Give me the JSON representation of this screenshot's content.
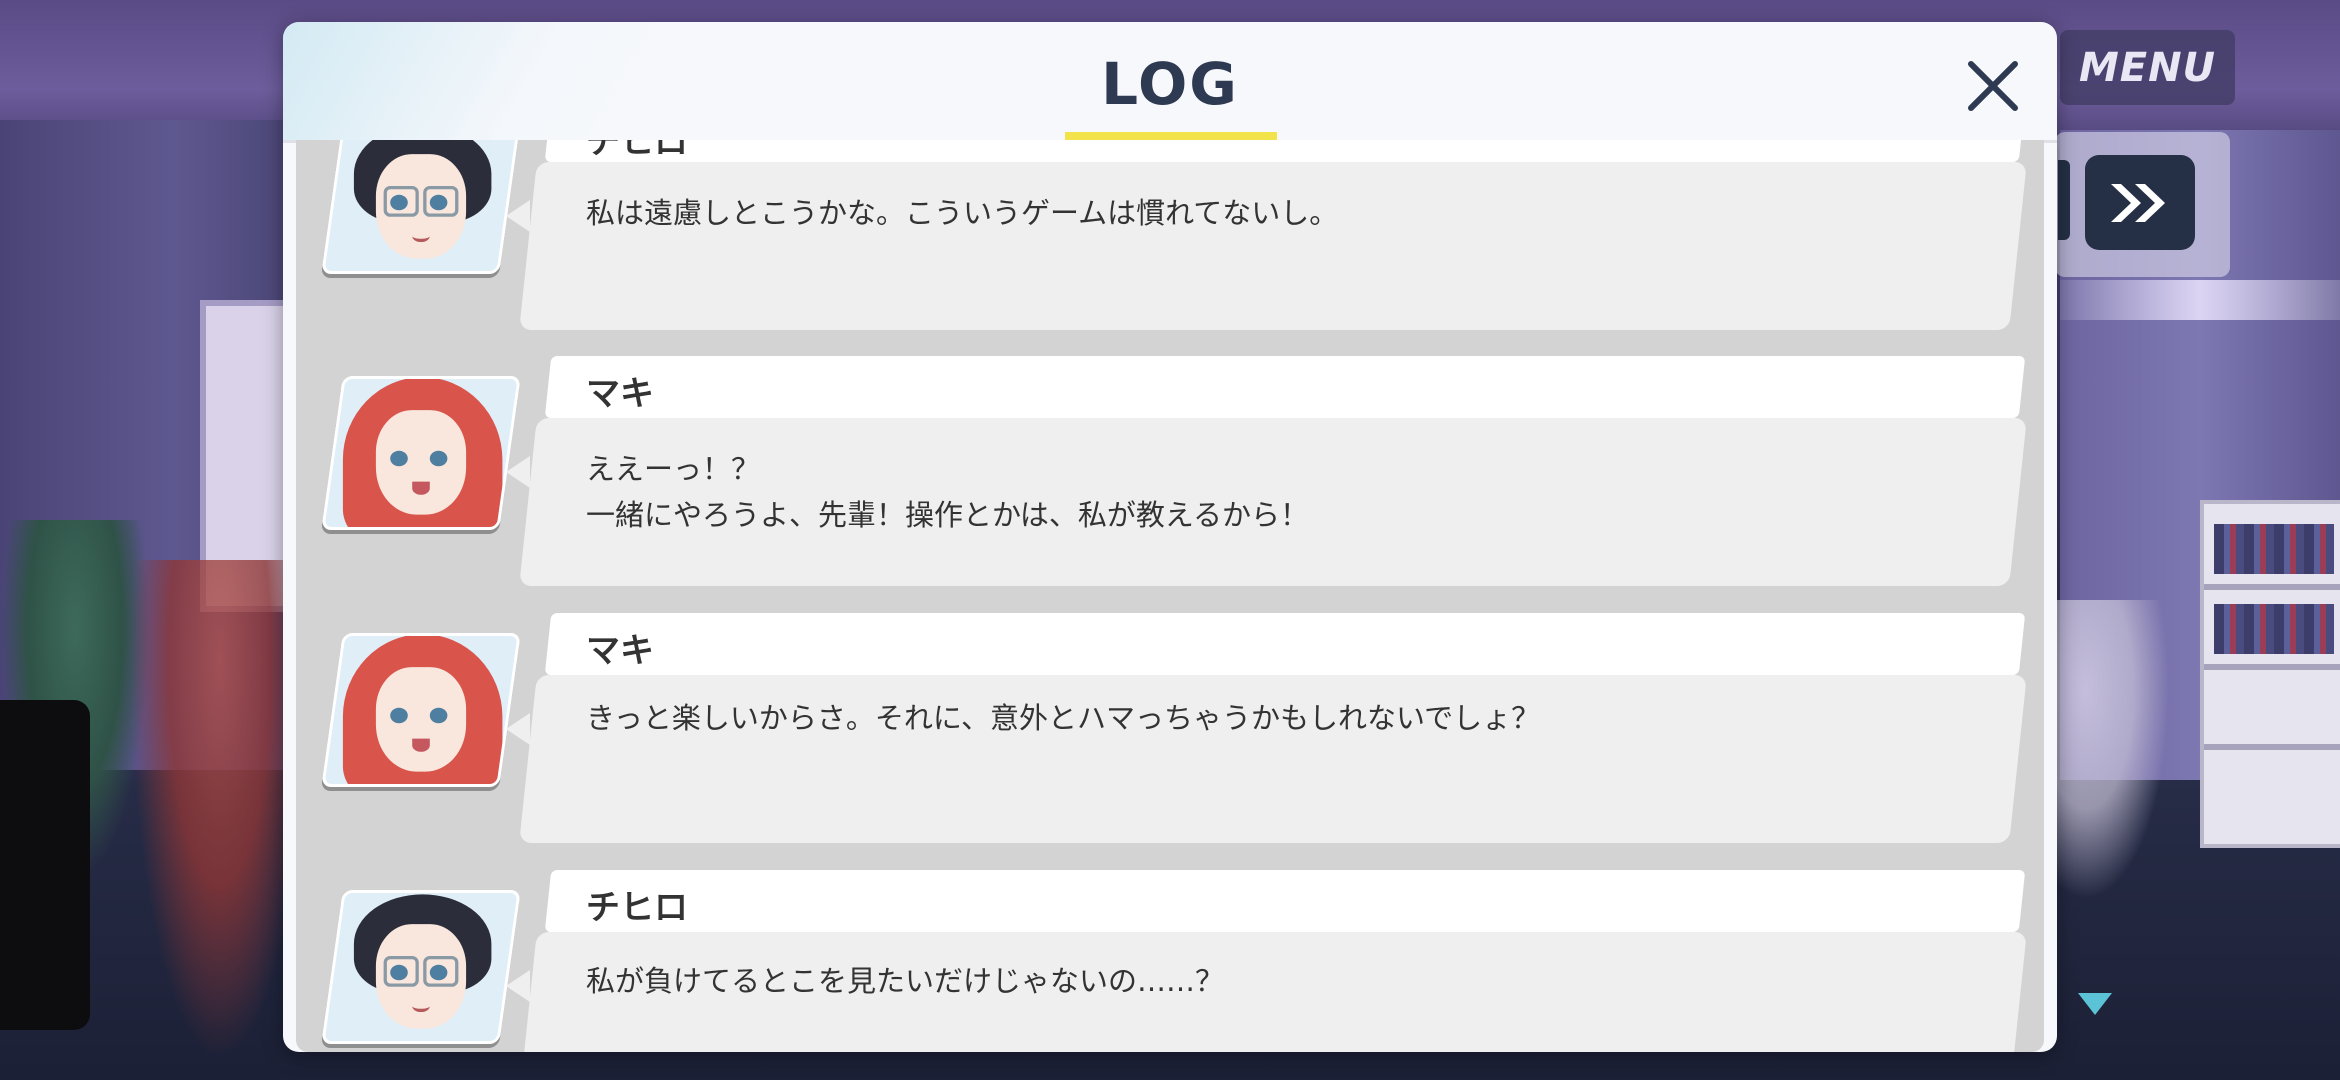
{
  "header": {
    "title": "LOG"
  },
  "controls": {
    "menu_label": "MENU"
  },
  "entries": [
    {
      "speaker": "チヒロ",
      "lines": [
        "私は遠慮しとこうかな。こういうゲームは慣れてないし。"
      ]
    },
    {
      "speaker": "マキ",
      "lines": [
        "ええーっ！？",
        "一緒にやろうよ、先輩！操作とかは、私が教えるから！"
      ]
    },
    {
      "speaker": "マキ",
      "lines": [
        "きっと楽しいからさ。それに、意外とハマっちゃうかもしれないでしょ？"
      ]
    },
    {
      "speaker": "チヒロ",
      "lines": [
        "私が負けてるとこを見たいだけじゃないの……？"
      ]
    }
  ],
  "colors": {
    "title_underline": "#f3e34a",
    "title_text": "#2d3a52",
    "skip_button": "#253046"
  }
}
